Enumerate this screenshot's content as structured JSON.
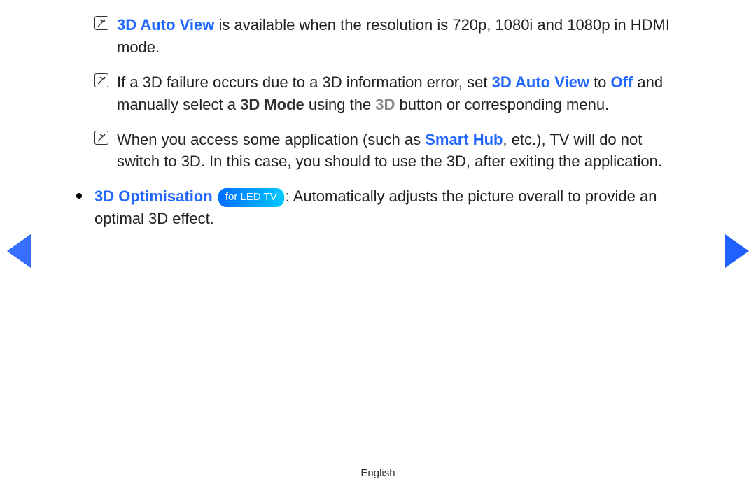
{
  "notes": [
    {
      "segments": [
        {
          "text": "3D Auto View",
          "class": "hl-blue"
        },
        {
          "text": " is available when the resolution is 720p, 1080i and 1080p in HDMI mode."
        }
      ]
    },
    {
      "segments": [
        {
          "text": "If a 3D failure occurs due to a 3D information error, set "
        },
        {
          "text": "3D Auto View",
          "class": "hl-blue"
        },
        {
          "text": " to "
        },
        {
          "text": "Off",
          "class": "hl-blue"
        },
        {
          "text": " and manually select a "
        },
        {
          "text": "3D Mode",
          "class": "hl-bold"
        },
        {
          "text": " using the "
        },
        {
          "text": "3D",
          "class": "hl-gray"
        },
        {
          "text": " button or corresponding menu."
        }
      ]
    },
    {
      "segments": [
        {
          "text": "When you access some application (such as "
        },
        {
          "text": "Smart Hub",
          "class": "hl-blue"
        },
        {
          "text": ", etc.), TV will do not switch to 3D. In this case, you should to use the 3D, after exiting the application."
        }
      ]
    }
  ],
  "bullet": {
    "title": "3D Optimisation",
    "pill": "for LED TV",
    "desc": ": Automatically adjusts the picture overall to provide an optimal 3D effect."
  },
  "footer": "English"
}
